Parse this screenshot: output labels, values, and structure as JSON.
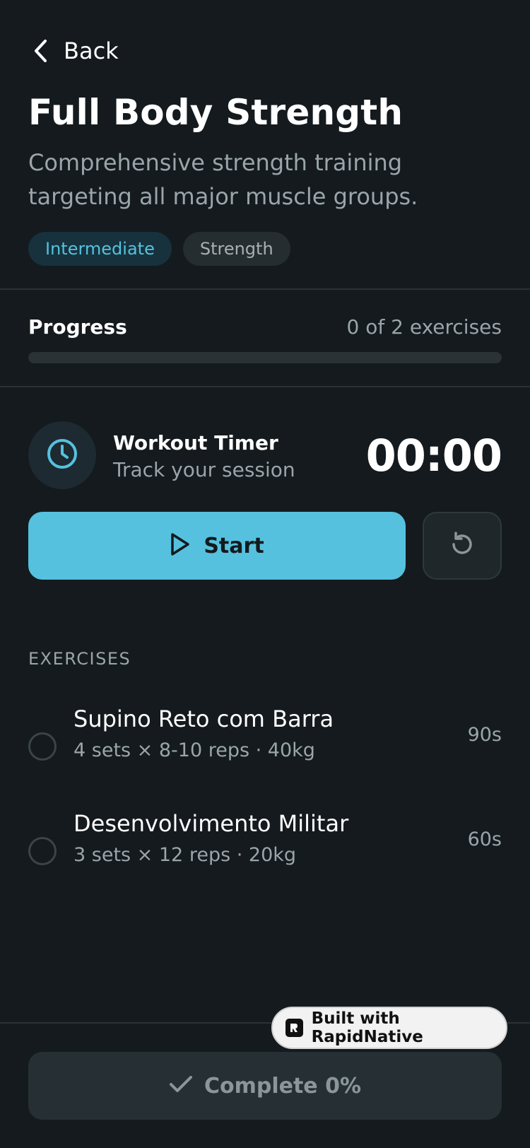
{
  "nav": {
    "back_label": "Back",
    "back_icon": "chevron-left-icon"
  },
  "workout": {
    "title": "Full Body Strength",
    "description": "Comprehensive strength training targeting all major muscle groups.",
    "tags": [
      "Intermediate",
      "Strength"
    ]
  },
  "progress": {
    "label": "Progress",
    "count_text": "0 of 2 exercises",
    "fraction": 0
  },
  "timer": {
    "icon": "clock-icon",
    "title": "Workout Timer",
    "subtitle": "Track your session",
    "value": "00:00",
    "start_label": "Start",
    "start_icon": "play-icon",
    "reset_icon": "reset-icon"
  },
  "exercises": {
    "heading": "EXERCISES",
    "items": [
      {
        "name": "Supino Reto com Barra",
        "meta": "4 sets × 8-10 reps · 40kg",
        "rest": "90s"
      },
      {
        "name": "Desenvolvimento Militar",
        "meta": "3 sets × 12 reps · 20kg",
        "rest": "60s"
      }
    ]
  },
  "footer": {
    "complete_label": "Complete 0%",
    "complete_icon": "check-icon"
  },
  "badge": {
    "label": "Built with RapidNative"
  },
  "colors": {
    "accent": "#56c1de",
    "background": "#141a1e",
    "muted": "#9aa5ab"
  }
}
